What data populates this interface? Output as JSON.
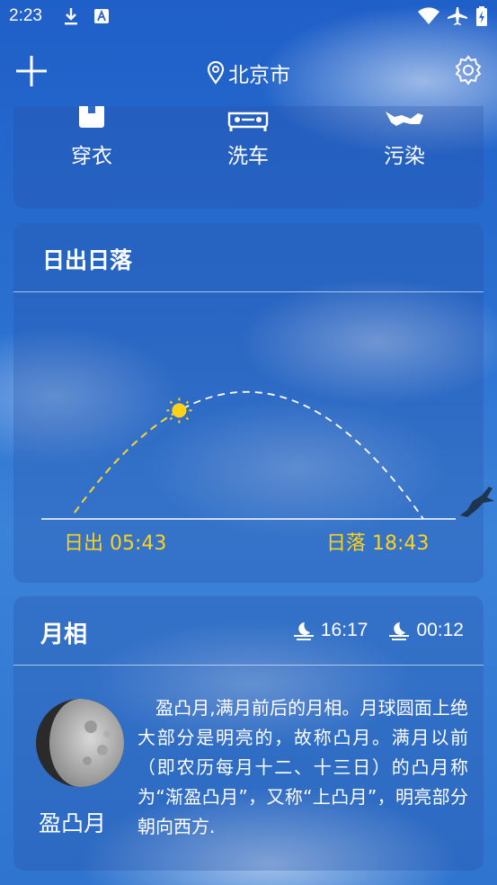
{
  "status_bar": {
    "time": "2:23",
    "icons": [
      "download-icon",
      "keyboard-a-icon",
      "wifi-icon",
      "airplane-icon",
      "battery-icon"
    ]
  },
  "top_bar": {
    "add_icon": "plus-icon",
    "location_icon": "location-pin-icon",
    "city": "北京市",
    "settings_icon": "gear-icon"
  },
  "lifestyle": {
    "items": [
      {
        "label": "穿衣",
        "icon": "clothing-icon"
      },
      {
        "label": "洗车",
        "icon": "car-icon"
      },
      {
        "label": "污染",
        "icon": "pollution-icon"
      }
    ]
  },
  "sun": {
    "title": "日出日落",
    "sunrise_label": "日出 05:43",
    "sunset_label": "日落 18:43",
    "progress": 0.3,
    "colors": {
      "accent": "#ffd21a"
    }
  },
  "moon": {
    "title": "月相",
    "moonrise_time": "16:17",
    "moonset_time": "00:12",
    "phase": "盈凸月",
    "description": "盈凸月,满月前后的月相。月球圆面上绝大部分是明亮的，故称凸月。满月以前（即农历每月十二、十三日）的凸月称为“渐盈凸月”，又称“上凸月”，明亮部分朝向西方."
  }
}
